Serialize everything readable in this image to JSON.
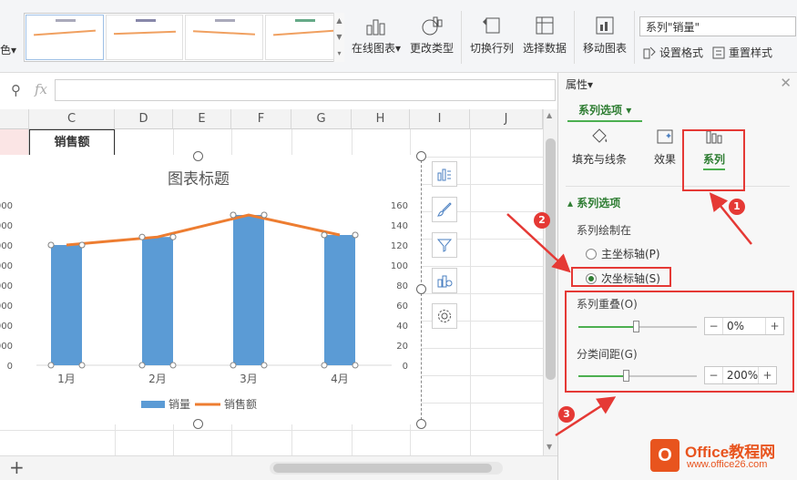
{
  "ribbon": {
    "color_label": "色",
    "buttons": [
      {
        "label": "在线图表",
        "dropdown": true
      },
      {
        "label": "更改类型"
      },
      {
        "label": "切换行列"
      },
      {
        "label": "选择数据"
      },
      {
        "label": "移动图表"
      }
    ],
    "series_selector": "系列\"销量\"",
    "set_format": "设置格式",
    "reset_style": "重置样式"
  },
  "formula": {
    "fx": "fx",
    "value": ""
  },
  "sheet": {
    "columns": [
      "C",
      "D",
      "E",
      "F",
      "G",
      "H",
      "I",
      "J"
    ],
    "cell_c2": "销售额"
  },
  "panel": {
    "title": "属性",
    "tab": "系列选项",
    "icons": [
      {
        "label": "填充与线条",
        "icon": "fill-bucket-icon"
      },
      {
        "label": "效果",
        "icon": "effects-icon"
      },
      {
        "label": "系列",
        "icon": "series-bars-icon"
      }
    ],
    "section": "系列选项",
    "plot_on": "系列绘制在",
    "primary_axis": "主坐标轴(P)",
    "secondary_axis": "次坐标轴(S)",
    "overlap_label": "系列重叠(O)",
    "overlap_value": "0%",
    "gap_label": "分类间距(G)",
    "gap_value": "200%"
  },
  "annotations": [
    "1",
    "2",
    "3"
  ],
  "watermark": {
    "brand": "Office教程网",
    "url": "www.office26.com",
    "logo_letter": "O"
  },
  "colors": {
    "bar": "#5b9bd5",
    "line": "#ed7d31",
    "accent": "#4caf50",
    "annotation": "#e53935"
  },
  "chart_data": {
    "type": "bar",
    "title": "图表标题",
    "categories": [
      "1月",
      "2月",
      "3月",
      "4月"
    ],
    "series": [
      {
        "name": "销量",
        "type": "bar",
        "axis": "primary",
        "values": [
          1200,
          1280,
          1500,
          1300
        ]
      },
      {
        "name": "销售额",
        "type": "line",
        "axis": "secondary",
        "values": [
          120,
          128,
          150,
          130
        ]
      }
    ],
    "y_left_ticks": [
      "000",
      "000",
      "000",
      "000",
      "000",
      "000",
      "000",
      "000",
      "0"
    ],
    "y_right_ticks": [
      "160",
      "140",
      "120",
      "100",
      "80",
      "60",
      "40",
      "20",
      "0"
    ],
    "ylim_left": [
      0,
      1600
    ],
    "ylim_right": [
      0,
      160
    ],
    "legend": "bottom",
    "grid": false
  }
}
